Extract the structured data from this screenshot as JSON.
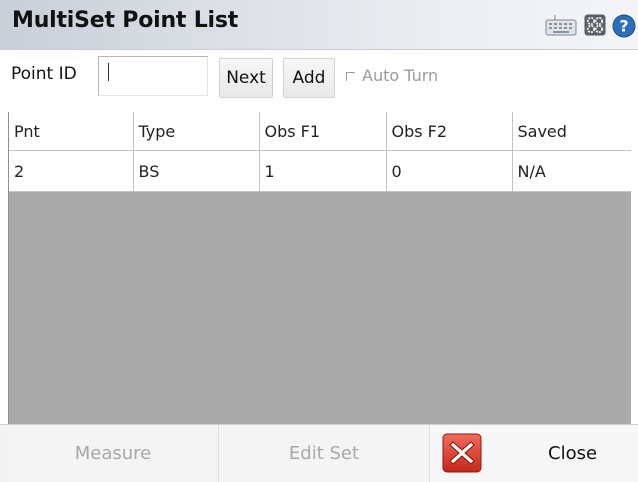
{
  "window": {
    "title": "MultiSet Point List",
    "icons": [
      "keyboard-icon",
      "gear-icon",
      "help-icon"
    ]
  },
  "toolbar": {
    "point_id_label": "Point ID",
    "point_id_value": "",
    "next_label": "Next",
    "add_label": "Add",
    "auto_turn_label": "Auto Turn",
    "auto_turn_checked": false
  },
  "table": {
    "columns": [
      "Pnt",
      "Type",
      "Obs F1",
      "Obs F2",
      "Saved"
    ],
    "rows": [
      [
        "2",
        "BS",
        "1",
        "0",
        "N/A"
      ]
    ]
  },
  "bottom_bar": {
    "measure_label": "Measure",
    "edit_set_label": "Edit Set",
    "close_label": "Close"
  },
  "colors": {
    "empty_area": "#a9a9a9",
    "close_icon_red": "#d93a2a",
    "help_blue": "#2a6fb8",
    "disabled_text": "#a8a8a8"
  }
}
